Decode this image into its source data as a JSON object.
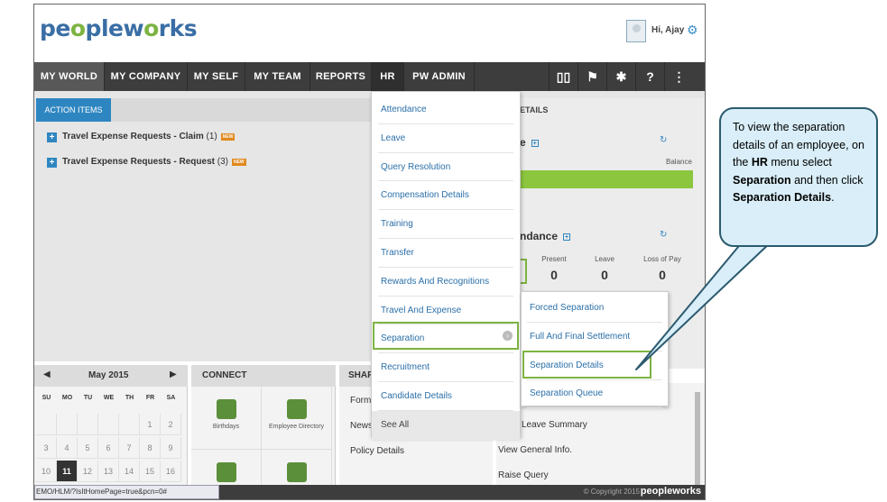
{
  "brand": {
    "logo_text": "peopleworks"
  },
  "user": {
    "greeting": "Hi, Ajay"
  },
  "nav": {
    "items": [
      "MY WORLD",
      "MY COMPANY",
      "MY SELF",
      "MY TEAM",
      "REPORTS",
      "HR",
      "PW ADMIN"
    ]
  },
  "action_items": {
    "tab_label": "ACTION ITEMS",
    "rows": [
      {
        "label": "Travel Expense Requests - Claim",
        "count": "(1)",
        "badge": "NEW"
      },
      {
        "label": "Travel Expense Requests - Request",
        "count": "(3)",
        "badge": "NEW"
      }
    ]
  },
  "details_panel": {
    "header": "ETAILS",
    "leave_title": "e",
    "balance_label": "Balance",
    "attendance_title": "ndance",
    "present_label": "Present",
    "present_value": "0",
    "leave_label": "Leave",
    "leave_value": "0",
    "lop_label": "Loss of Pay",
    "lop_value": "0"
  },
  "hr_menu": {
    "items": [
      "Attendance",
      "Leave",
      "Query Resolution",
      "Compensation Details",
      "Training",
      "Transfer",
      "Rewards And Recognitions",
      "Travel And Expense",
      "Separation",
      "Recruitment",
      "Candidate Details"
    ],
    "see_all": "See All"
  },
  "separation_submenu": {
    "items": [
      "Forced Separation",
      "Full And Final Settlement",
      "Separation Details",
      "Separation Queue"
    ]
  },
  "calendar": {
    "title": "May 2015",
    "dow": [
      "SU",
      "MO",
      "TU",
      "WE",
      "TH",
      "FR",
      "SA"
    ],
    "rows": [
      [
        "",
        "",
        "",
        "",
        "",
        "1",
        "2"
      ],
      [
        "3",
        "4",
        "5",
        "6",
        "7",
        "8",
        "9"
      ],
      [
        "10",
        "11",
        "12",
        "13",
        "14",
        "15",
        "16"
      ]
    ],
    "today": "11"
  },
  "connect": {
    "title": "CONNECT",
    "tiles": [
      "Birthdays",
      "Employee Directory"
    ]
  },
  "share": {
    "title": "SHAR",
    "links": [
      "Form",
      "News",
      "Policy Details"
    ]
  },
  "quick_links": [
    "Leave Summary",
    "View General Info.",
    "Raise Query"
  ],
  "status": {
    "url": "EMO/HLM/?IsItHomePage=true&pcn=0#"
  },
  "footer": {
    "copyright": "© Copyright 2015",
    "logo": "peopleworks"
  },
  "callout": {
    "parts": [
      {
        "text": "To view the separation details of an employee, on the ",
        "bold": false
      },
      {
        "text": "HR",
        "bold": true
      },
      {
        "text": " menu select ",
        "bold": false
      },
      {
        "text": "Separation",
        "bold": true
      },
      {
        "text": " and then click ",
        "bold": false
      },
      {
        "text": "Separation Details",
        "bold": true
      },
      {
        "text": ".",
        "bold": false
      }
    ]
  },
  "colors": {
    "nav_bg": "#3d3d3d",
    "accent_blue": "#2e86c1",
    "menu_link": "#2a6fa8",
    "highlight_green": "#7cb342",
    "callout_bg": "#d9eef8",
    "callout_border": "#2b5a6e"
  }
}
